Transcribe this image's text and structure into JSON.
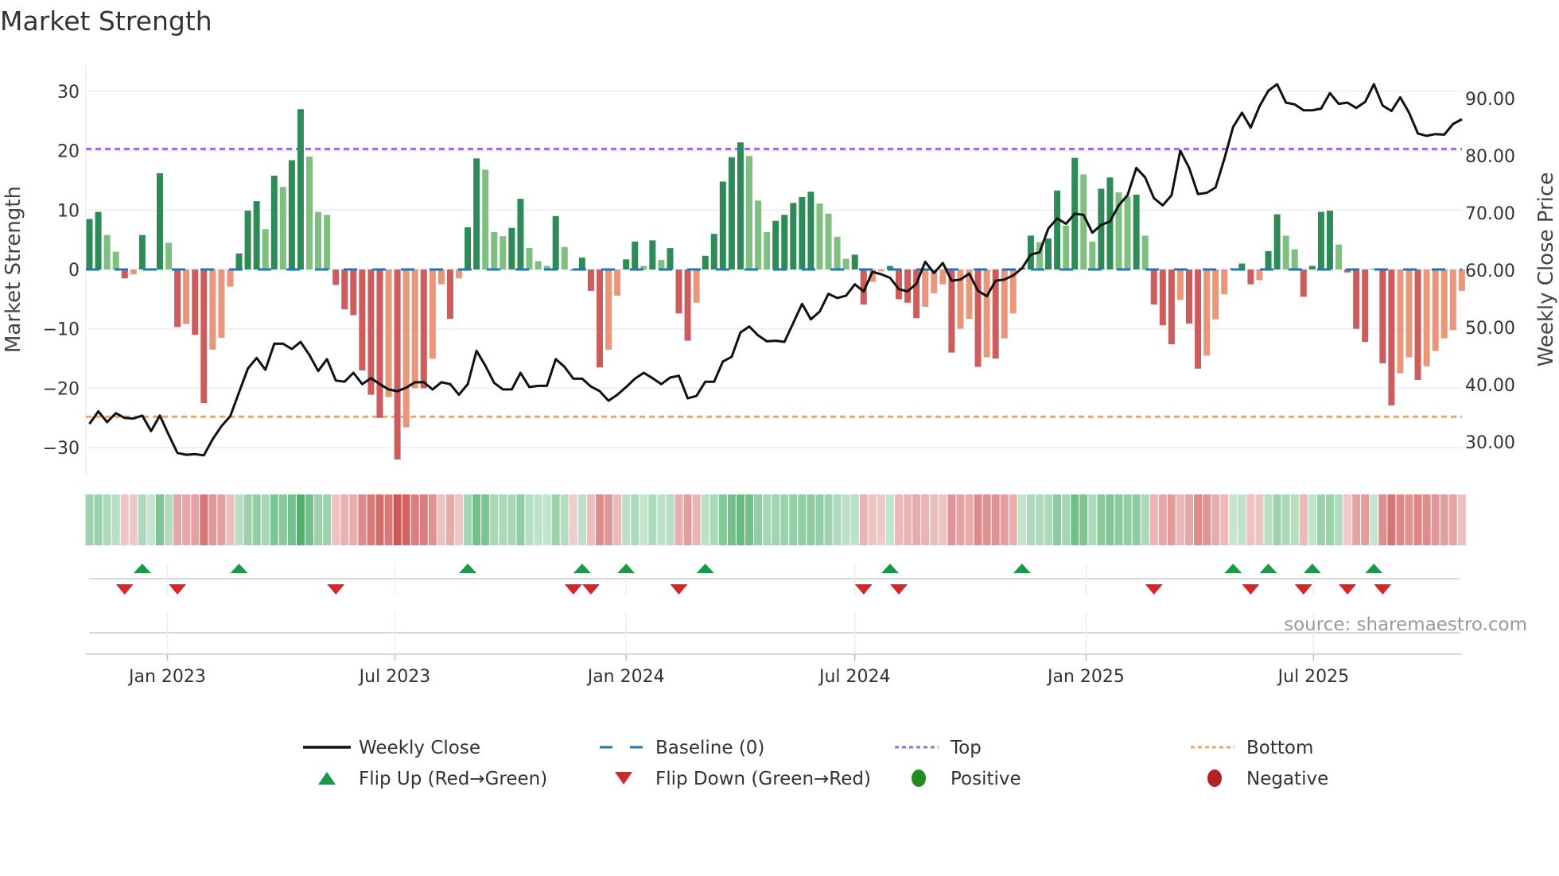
{
  "chart_data": {
    "type": "bar",
    "title": "Market Strength",
    "ylabel": "Market Strength",
    "y2label": "Weekly Close Price",
    "ylim": [
      -34.5,
      34.5
    ],
    "y2lim": [
      24,
      96
    ],
    "yticks": [
      30,
      20,
      10,
      0,
      -10,
      -20,
      -30
    ],
    "yticklabels": [
      "30",
      "20",
      "10",
      "0",
      "−10",
      "−20",
      "−30"
    ],
    "y2ticks": [
      90,
      80,
      70,
      60,
      50,
      40,
      30
    ],
    "y2ticklabels": [
      "90.00",
      "80.00",
      "70.00",
      "60.00",
      "50.00",
      "40.00",
      "30.00"
    ],
    "frequency": "weekly",
    "start_date": "2022-10-31",
    "xticks": [
      {
        "date": "2023-01-01",
        "label": "Jan 2023"
      },
      {
        "date": "2023-07-01",
        "label": "Jul 2023"
      },
      {
        "date": "2024-01-01",
        "label": "Jan 2024"
      },
      {
        "date": "2024-07-01",
        "label": "Jul 2024"
      },
      {
        "date": "2025-01-01",
        "label": "Jan 2025"
      },
      {
        "date": "2025-07-01",
        "label": "Jul 2025"
      }
    ],
    "top_level": 20.3,
    "bottom_level": -24.8,
    "baseline": 0,
    "strength": [
      8.5,
      9.7,
      5.8,
      3,
      -1.5,
      -0.8,
      5.8,
      0,
      16.2,
      4.5,
      -9.7,
      -9.2,
      -11,
      -22.5,
      -13.5,
      -11.5,
      -2.9,
      2.7,
      9.9,
      11.5,
      6.8,
      15.8,
      13.9,
      18.4,
      27,
      19,
      9.7,
      9.2,
      -2.6,
      -6.7,
      -7.7,
      -17,
      -21.1,
      -25,
      -21.5,
      -32,
      -26.6,
      -20,
      -20,
      -15,
      -2.5,
      -8.3,
      -1.5,
      7.1,
      18.7,
      16.8,
      6.3,
      5.6,
      7,
      11.9,
      3.6,
      1.4,
      0.6,
      9,
      3.8,
      -0.2,
      2,
      -3.6,
      -16.5,
      -13.5,
      -4.4,
      1.7,
      4.7,
      0.6,
      4.9,
      1.6,
      3.6,
      -7.4,
      -12,
      -5.6,
      2.3,
      6,
      14.8,
      18.9,
      21.4,
      19.1,
      11.6,
      6.3,
      8.2,
      9.2,
      11.2,
      12.2,
      13.1,
      11.1,
      9.4,
      5.5,
      1.8,
      2.5,
      -5.9,
      -2.1,
      -0.3,
      0.6,
      -5,
      -5.6,
      -8.2,
      -6.3,
      -4,
      -2.5,
      -14,
      -10,
      -8.3,
      -16.4,
      -14.8,
      -15,
      -11.6,
      -7.4,
      0.3,
      5.7,
      4.6,
      5.2,
      13.3,
      7.4,
      18.8,
      16,
      4.7,
      13.6,
      15.5,
      13,
      12.3,
      12.6,
      5.7,
      -5.9,
      -9.4,
      -12.6,
      -5.1,
      -9.1,
      -16.7,
      -14.5,
      -8.4,
      -4.2,
      0.2,
      1,
      -2.5,
      -1.8,
      3.1,
      9.3,
      5.7,
      3.4,
      -4.6,
      0.6,
      9.7,
      9.9,
      4.2,
      -0.5,
      -10,
      -12.2,
      0.1,
      -15.8,
      -22.9,
      -17.5,
      -14.8,
      -18.6,
      -16.3,
      -13.7,
      -11.6,
      -10.2,
      -3.6
    ],
    "weekly_close": [
      34.0,
      36.1,
      34.3,
      35.8,
      35.0,
      34.9,
      35.4,
      32.8,
      35.4,
      32.2,
      29.1,
      28.8,
      28.9,
      28.7,
      31.4,
      33.6,
      35.3,
      39.3,
      43.3,
      45.1,
      43.1,
      47.5,
      47.5,
      46.6,
      47.8,
      45.6,
      42.9,
      44.9,
      41.3,
      41.1,
      42.6,
      40.7,
      41.7,
      40.7,
      39.8,
      39.5,
      40.1,
      41.0,
      41.0,
      39.8,
      41.0,
      40.7,
      38.9,
      40.7,
      46.3,
      43.8,
      40.9,
      39.8,
      39.8,
      42.6,
      40.2,
      40.4,
      40.4,
      44.9,
      43.6,
      41.6,
      41.6,
      40.3,
      39.5,
      37.9,
      38.9,
      40.2,
      41.6,
      42.6,
      41.7,
      40.7,
      41.8,
      42.1,
      38.3,
      38.7,
      41.1,
      41.1,
      44.5,
      45.3,
      49.4,
      50.4,
      48.9,
      47.9,
      48.0,
      47.8,
      51.0,
      54.2,
      51.6,
      52.9,
      55.9,
      55.2,
      55.6,
      57.5,
      56.3,
      59.6,
      59.2,
      58.6,
      56.7,
      56.3,
      57.6,
      61.3,
      59.4,
      61.1,
      58.1,
      58.3,
      59.3,
      56.4,
      55.5,
      58.1,
      58.3,
      59.0,
      60.2,
      62.5,
      62.9,
      66.9,
      68.6,
      67.7,
      69.4,
      69.2,
      66.2,
      67.5,
      68.1,
      70.8,
      72.5,
      77.1,
      75.5,
      72.0,
      70.8,
      72.5,
      80.0,
      77.1,
      72.7,
      72.9,
      73.8,
      78.6,
      84.0,
      86.4,
      83.9,
      87.5,
      90.1,
      91.2,
      88.1,
      87.8,
      86.8,
      86.8,
      87.1,
      89.7,
      87.9,
      88.1,
      87.2,
      88.2,
      91.2,
      87.6,
      86.7,
      89.0,
      86.4,
      82.9,
      82.5,
      82.8,
      82.7,
      84.5,
      85.3
    ],
    "flip_up_weeks": [
      6,
      17,
      43,
      56,
      61,
      70,
      91,
      106,
      130,
      134,
      139,
      146
    ],
    "flip_down_weeks": [
      4,
      10,
      28,
      55,
      57,
      67,
      88,
      92,
      121,
      132,
      138,
      143,
      147
    ],
    "legend": [
      {
        "key": "close",
        "label": "Weekly Close"
      },
      {
        "key": "baseline",
        "label": "Baseline (0)"
      },
      {
        "key": "top",
        "label": "Top"
      },
      {
        "key": "bottom",
        "label": "Bottom"
      },
      {
        "key": "flip_up",
        "label": "Flip Up (Red→Green)"
      },
      {
        "key": "flip_down",
        "label": "Flip Down (Green→Red)"
      },
      {
        "key": "positive",
        "label": "Positive"
      },
      {
        "key": "negative",
        "label": "Negative"
      }
    ],
    "legend_placement": "bottom",
    "grid": true
  },
  "source": "source: sharemaestro.com",
  "colors": {
    "pos_strong": "#2e8b57",
    "pos_weak": "#7fbf7f",
    "neg_strong": "#cd5c5c",
    "neg_weak": "#e9967a",
    "baseline": "#1f77b4",
    "top": "#9b6be0",
    "bottom": "#f4a261",
    "flip_up": "#1a9a48",
    "flip_down": "#d62728",
    "positive": "#228b22",
    "negative": "#b22222",
    "close": "#111111"
  }
}
